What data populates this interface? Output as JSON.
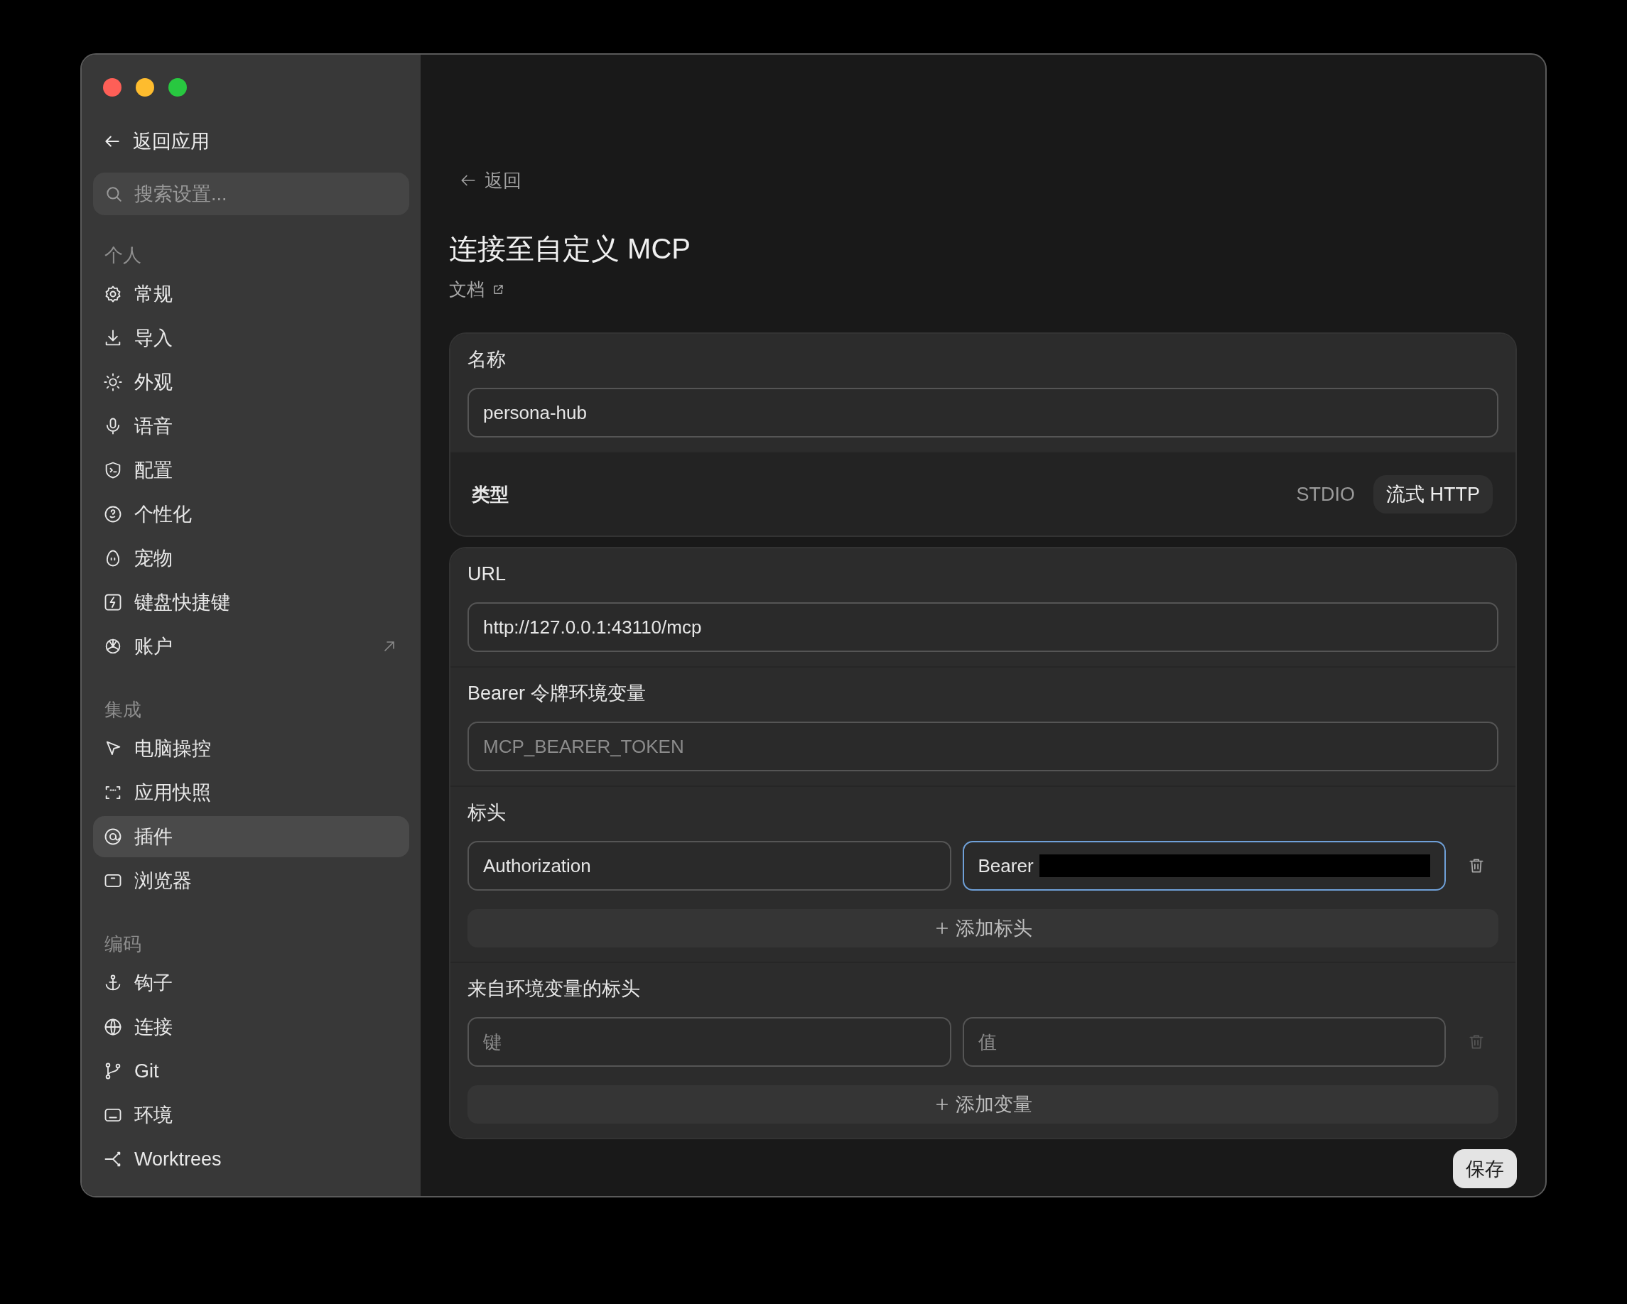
{
  "sidebar": {
    "back": "返回应用",
    "search": {
      "placeholder": "搜索设置..."
    },
    "groups": [
      {
        "title": "个人",
        "items": [
          {
            "label": "常规",
            "selected": false,
            "external": false
          },
          {
            "label": "导入",
            "selected": false,
            "external": false
          },
          {
            "label": "外观",
            "selected": false,
            "external": false
          },
          {
            "label": "语音",
            "selected": false,
            "external": false
          },
          {
            "label": "配置",
            "selected": false,
            "external": false
          },
          {
            "label": "个性化",
            "selected": false,
            "external": false
          },
          {
            "label": "宠物",
            "selected": false,
            "external": false
          },
          {
            "label": "键盘快捷键",
            "selected": false,
            "external": false
          },
          {
            "label": "账户",
            "selected": false,
            "external": true
          }
        ]
      },
      {
        "title": "集成",
        "items": [
          {
            "label": "电脑操控",
            "selected": false,
            "external": false
          },
          {
            "label": "应用快照",
            "selected": false,
            "external": false
          },
          {
            "label": "插件",
            "selected": true,
            "external": false
          },
          {
            "label": "浏览器",
            "selected": false,
            "external": false
          }
        ]
      },
      {
        "title": "编码",
        "items": [
          {
            "label": "钩子",
            "selected": false,
            "external": false
          },
          {
            "label": "连接",
            "selected": false,
            "external": false
          },
          {
            "label": "Git",
            "selected": false,
            "external": false
          },
          {
            "label": "环境",
            "selected": false,
            "external": false
          },
          {
            "label": "Worktrees",
            "selected": false,
            "external": false
          }
        ]
      }
    ]
  },
  "main": {
    "back": "返回",
    "title": "连接至自定义 MCP",
    "docs_link": "文档",
    "name": {
      "label": "名称",
      "value": "persona-hub"
    },
    "type": {
      "label": "类型",
      "options": [
        {
          "label": "STDIO",
          "selected": false
        },
        {
          "label": "流式 HTTP",
          "selected": true
        }
      ]
    },
    "url": {
      "label": "URL",
      "value": "http://127.0.0.1:43110/mcp"
    },
    "bearer": {
      "label": "Bearer 令牌环境变量",
      "placeholder": "MCP_BEARER_TOKEN"
    },
    "headers": {
      "label": "标头",
      "rows": [
        {
          "key": "Authorization",
          "value": "Bearer",
          "redacted": true,
          "focused": true,
          "delete_disabled": false
        }
      ],
      "add": "添加标头"
    },
    "env_headers": {
      "label": "来自环境变量的标头",
      "rows": [
        {
          "key_placeholder": "键",
          "value_placeholder": "值",
          "delete_disabled": true
        }
      ],
      "add": "添加变量"
    },
    "save": "保存"
  }
}
